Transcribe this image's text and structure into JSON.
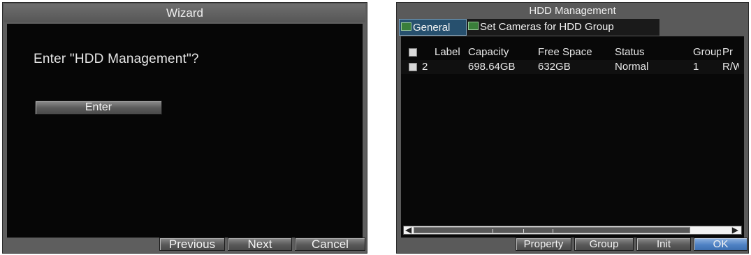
{
  "wizard": {
    "title": "Wizard",
    "prompt": "Enter \"HDD Management\"?",
    "enter_label": "Enter",
    "footer": {
      "previous": "Previous",
      "next": "Next",
      "cancel": "Cancel"
    }
  },
  "hdd": {
    "title": "HDD Management",
    "tabs": [
      {
        "label": "General",
        "active": true
      },
      {
        "label": "Set Cameras for HDD Group",
        "active": false
      }
    ],
    "columns": [
      "Label",
      "Capacity",
      "Free Space",
      "Status",
      "Group",
      "Pr"
    ],
    "rows": [
      {
        "label": "2",
        "capacity": "698.64GB",
        "free_space": "632GB",
        "status": "Normal",
        "group": "1",
        "pr": "R/W"
      }
    ],
    "footer": {
      "property": "Property",
      "group": "Group",
      "init": "Init",
      "ok": "OK"
    }
  }
}
